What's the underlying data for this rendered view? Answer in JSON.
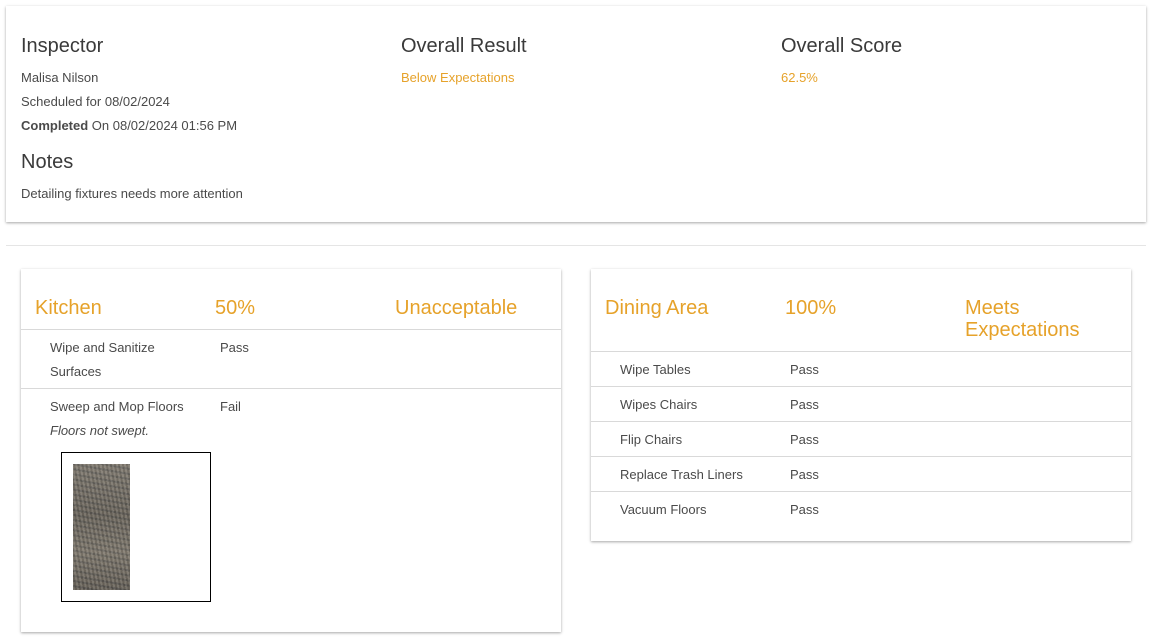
{
  "summary": {
    "inspector_heading": "Inspector",
    "inspector_name": "Malisa Nilson",
    "scheduled": "Scheduled for 08/02/2024",
    "completed_label": "Completed",
    "completed_value": " On 08/02/2024 01:56 PM",
    "notes_heading": "Notes",
    "notes_text": "Detailing fixtures needs more attention",
    "result_heading": "Overall Result",
    "result_value": "Below Expectations",
    "score_heading": "Overall Score",
    "score_value": "62.5%"
  },
  "areas": [
    {
      "name": "Kitchen",
      "score": "50%",
      "rating": "Unacceptable",
      "tasks": [
        {
          "task": "Wipe and Sanitize Surfaces",
          "result": "Pass"
        },
        {
          "task": "Sweep and Mop Floors",
          "result": "Fail",
          "note": "Floors not swept."
        }
      ]
    },
    {
      "name": "Dining Area",
      "score": "100%",
      "rating": "Meets Expectations",
      "tasks": [
        {
          "task": "Wipe Tables",
          "result": "Pass"
        },
        {
          "task": "Wipes Chairs",
          "result": "Pass"
        },
        {
          "task": "Flip Chairs",
          "result": "Pass"
        },
        {
          "task": "Replace Trash Liners",
          "result": "Pass"
        },
        {
          "task": "Vacuum Floors",
          "result": "Pass"
        }
      ]
    }
  ],
  "colors": {
    "accent": "#e6a22a",
    "text": "#3c3c3c"
  }
}
